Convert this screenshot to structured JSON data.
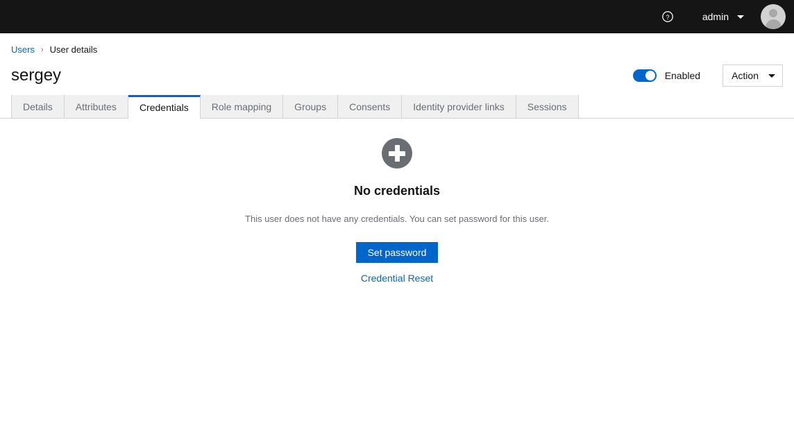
{
  "masthead": {
    "help_icon": "help-circle-icon",
    "user_name": "admin",
    "caret_icon": "chevron-down-icon",
    "avatar_icon": "user-avatar-icon"
  },
  "breadcrumb": {
    "parent": "Users",
    "separator": "›",
    "current": "User details"
  },
  "page": {
    "title": "sergey",
    "toggle_label": "Enabled",
    "toggle_state": "on",
    "action_label": "Action",
    "action_caret_icon": "caret-down-icon"
  },
  "tabs": [
    {
      "label": "Details",
      "active": false
    },
    {
      "label": "Attributes",
      "active": false
    },
    {
      "label": "Credentials",
      "active": true
    },
    {
      "label": "Role mapping",
      "active": false
    },
    {
      "label": "Groups",
      "active": false
    },
    {
      "label": "Consents",
      "active": false
    },
    {
      "label": "Identity provider links",
      "active": false
    },
    {
      "label": "Sessions",
      "active": false
    }
  ],
  "empty_state": {
    "icon": "plus-circle-icon",
    "title": "No credentials",
    "description": "This user does not have any credentials. You can set password for this user.",
    "primary_button": "Set password",
    "link_button": "Credential Reset"
  },
  "colors": {
    "masthead_bg": "#151515",
    "accent_blue": "#0066cc",
    "tab_inactive_bg": "#f0f0f0",
    "muted_text": "#6a6e73",
    "icon_gray": "#6a6e73",
    "border": "#d2d2d2"
  }
}
